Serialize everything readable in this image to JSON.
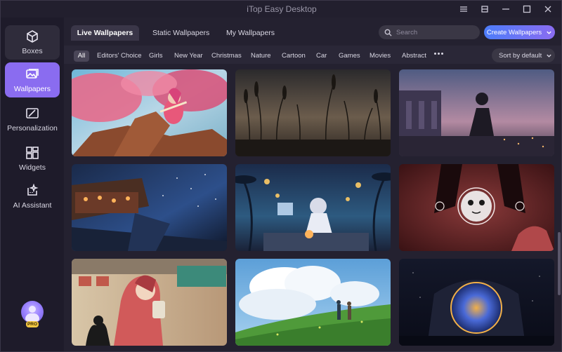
{
  "window": {
    "title": "iTop Easy Desktop",
    "controls": [
      "menu-icon",
      "restore-icon",
      "minimize-icon",
      "maximize-icon",
      "close-icon"
    ]
  },
  "sidebar": {
    "items": [
      {
        "label": "Boxes",
        "icon": "box-icon",
        "active": false
      },
      {
        "label": "Wallpapers",
        "icon": "image-icon",
        "active": true
      },
      {
        "label": "Personalization",
        "icon": "brush-icon",
        "active": false
      },
      {
        "label": "Widgets",
        "icon": "widgets-icon",
        "active": false
      },
      {
        "label": "AI Assistant",
        "icon": "ai-sparkle-icon",
        "active": false
      }
    ],
    "badge": "PRO"
  },
  "tabs": [
    {
      "label": "Live Wallpapers",
      "active": true
    },
    {
      "label": "Static Wallpapers",
      "active": false
    },
    {
      "label": "My Wallpapers",
      "active": false
    }
  ],
  "search": {
    "placeholder": "Search",
    "value": ""
  },
  "create_button": {
    "label": "Create Wallpapers"
  },
  "categories": [
    "All",
    "Editors' Choice",
    "Girls",
    "New Year",
    "Christmas",
    "Nature",
    "Cartoon",
    "Car",
    "Games",
    "Movies",
    "Abstract"
  ],
  "selected_category": "All",
  "sort": {
    "label": "Sort by default"
  },
  "wallpapers": [
    {
      "subject": "anime girl with flute in pink blossom tree"
    },
    {
      "subject": "reeds silhouette at dusk"
    },
    {
      "subject": "boy sitting by ruins at sunset"
    },
    {
      "subject": "night market under starry sky"
    },
    {
      "subject": "girl studying at desk by the sea"
    },
    {
      "subject": "creepy girl with masked face"
    },
    {
      "subject": "girl drinking with cat at street"
    },
    {
      "subject": "couple on grassy hill under clouds"
    },
    {
      "subject": "glowing portal in dark landscape"
    }
  ],
  "colors": {
    "accent": "#8a6cf0",
    "create_gradient_start": "#4d7dfa",
    "background": "#242130",
    "sidebar": "#1e1b2a"
  }
}
